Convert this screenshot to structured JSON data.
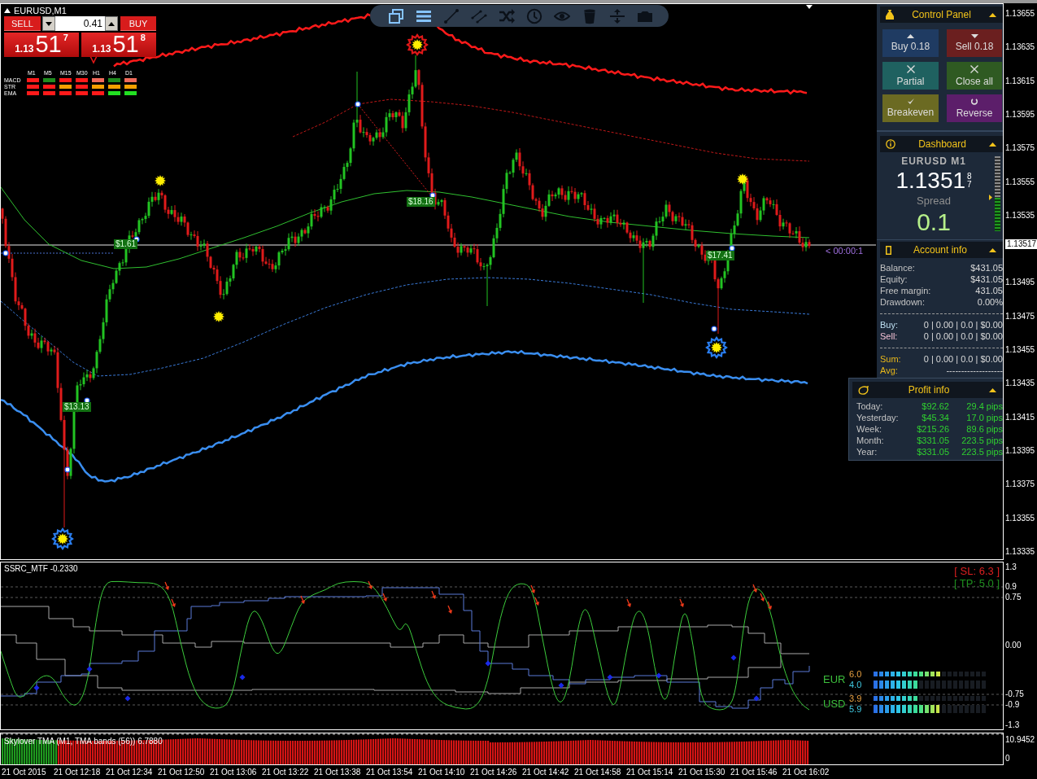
{
  "chart": {
    "symbol": "EURUSD,M1",
    "trade_labels": [
      "$1.61",
      "$18.16",
      "$13.13",
      "$17.41"
    ],
    "countdown": "< 00:00:1"
  },
  "trade_panel": {
    "sell_label": "SELL",
    "buy_label": "BUY",
    "lot": "0.41",
    "sell_price": {
      "big_figure": "1.13",
      "pips": "51",
      "fraction": "7"
    },
    "buy_price": {
      "big_figure": "1.13",
      "pips": "51",
      "fraction": "8"
    }
  },
  "signal_matrix": {
    "timeframes": [
      "M1",
      "M5",
      "M15",
      "M30",
      "H1",
      "H4",
      "D1"
    ],
    "rows": [
      {
        "label": "MACD",
        "cells": [
          {
            "color": "#ff1a1a"
          },
          {
            "color": "#1e8c1e"
          },
          {
            "color": "#ff1a1a"
          },
          {
            "color": "#ff1a1a"
          },
          {
            "color": "#f06a5a"
          },
          {
            "color": "#1e8c1e"
          },
          {
            "color": "#f06a5a"
          }
        ]
      },
      {
        "label": "STR",
        "cells": [
          {
            "color": "#ff1a1a"
          },
          {
            "color": "#ff1a1a"
          },
          {
            "color": "#f5a000"
          },
          {
            "color": "#ff1a1a"
          },
          {
            "color": "#f5a000"
          },
          {
            "color": "#f5a000"
          },
          {
            "color": "#f5a000"
          }
        ]
      },
      {
        "label": "EMA",
        "cells": [
          {
            "color": "#ff1a1a"
          },
          {
            "color": "#ff1a1a"
          },
          {
            "color": "#ff1a1a"
          },
          {
            "color": "#ff1a1a"
          },
          {
            "color": "#ff1a1a"
          },
          {
            "color": "#22e022"
          },
          {
            "color": "#22e022"
          }
        ]
      }
    ]
  },
  "toolbar": {
    "buttons": [
      {
        "on": true
      },
      {
        "on": true
      },
      {
        "on": false
      },
      {
        "on": false
      },
      {
        "on": false
      },
      {
        "on": false
      },
      {
        "on": false
      },
      {
        "on": false
      },
      {
        "on": false
      },
      {
        "on": false
      }
    ]
  },
  "control_panel": {
    "title": "Control Panel",
    "buttons": [
      {
        "label": "Buy 0.18",
        "color": "#1f3b62"
      },
      {
        "label": "Sell 0.18",
        "color": "#6b1f1f"
      },
      {
        "label": "Partial",
        "color": "#1f6160"
      },
      {
        "label": "Close all",
        "color": "#2f5a22"
      },
      {
        "label": "Breakeven",
        "color": "#6b6a22"
      },
      {
        "label": "Reverse",
        "color": "#5c1e6a"
      }
    ]
  },
  "dashboard": {
    "title": "Dashboard",
    "symbol": "EURUSD M1",
    "price": "1.1351",
    "price_digit_upper": "8",
    "price_digit_lower": "7",
    "spread_label": "Spread",
    "spread": "0.1",
    "meter": {
      "level": 0.45
    }
  },
  "account_info": {
    "title": "Account info",
    "rows": [
      {
        "label": "Balance:",
        "value": "$431.05"
      },
      {
        "label": "Equity:",
        "value": "$431.05"
      },
      {
        "label": "Free margin:",
        "value": "431.05"
      },
      {
        "label": "Drawdown:",
        "value": "0.00%"
      }
    ],
    "positions": [
      {
        "label": "Buy:",
        "value": "0 | 0.00 | 0.0 | $0.00",
        "color": "#bfe0f2"
      },
      {
        "label": "Sell:",
        "value": "0 | 0.00 | 0.0 | $0.00",
        "color": "#f2c0d4"
      }
    ],
    "totals": [
      {
        "label": "Sum:",
        "value": "0 | 0.00 | 0.0 | $0.00"
      },
      {
        "label": "Avg:",
        "value": "-------------------"
      }
    ]
  },
  "profit_info": {
    "title": "Profit info",
    "rows": [
      {
        "label": "Today:",
        "amount": "$92.62",
        "pips": "29.4 pips"
      },
      {
        "label": "Yesterday:",
        "amount": "$45.34",
        "pips": "17.0 pips"
      },
      {
        "label": "Week:",
        "amount": "$215.26",
        "pips": "89.6 pips"
      },
      {
        "label": "Month:",
        "amount": "$331.05",
        "pips": "223.5 pips"
      },
      {
        "label": "Year:",
        "amount": "$331.05",
        "pips": "223.5 pips"
      }
    ]
  },
  "price_axis": {
    "labels": [
      "1.13655",
      "1.13635",
      "1.13615",
      "1.13595",
      "1.13575",
      "1.13555",
      "1.13535",
      "1.13495",
      "1.13475",
      "1.13455",
      "1.13435",
      "1.13415",
      "1.13395",
      "1.13375",
      "1.13355",
      "1.13335"
    ],
    "current": "1.13517"
  },
  "oscillator_pane": {
    "title": "SSRC_MTF -0.2330",
    "stop_loss": "[ SL: 6.3 ]",
    "take_profit": "[ TP: 5.0 ]",
    "strength": [
      {
        "currency": "EUR",
        "bars": [
          {
            "value": "6.0",
            "level": 0.6
          },
          {
            "value": "4.0",
            "level": 0.4
          }
        ]
      },
      {
        "currency": "USD",
        "bars": [
          {
            "value": "3.9",
            "level": 0.39
          },
          {
            "value": "5.9",
            "level": 0.59
          }
        ]
      }
    ],
    "axis_labels": [
      "1.3",
      "0.9",
      "0.75",
      "0.00",
      "-0.75",
      "-0.9",
      "-1.3"
    ]
  },
  "tma_pane": {
    "title": "Skylover TMA (M1, TMA bands (56)) 6.7880",
    "axis_labels": [
      "10.9452",
      "0"
    ]
  },
  "time_axis": {
    "labels": [
      "21 Oct 2015",
      "21 Oct 12:18",
      "21 Oct 12:34",
      "21 Oct 12:50",
      "21 Oct 13:06",
      "21 Oct 13:22",
      "21 Oct 13:38",
      "21 Oct 13:54",
      "21 Oct 14:10",
      "21 Oct 14:26",
      "21 Oct 14:42",
      "21 Oct 14:58",
      "21 Oct 15:14",
      "21 Oct 15:30",
      "21 Oct 15:46",
      "21 Oct 16:02"
    ]
  }
}
